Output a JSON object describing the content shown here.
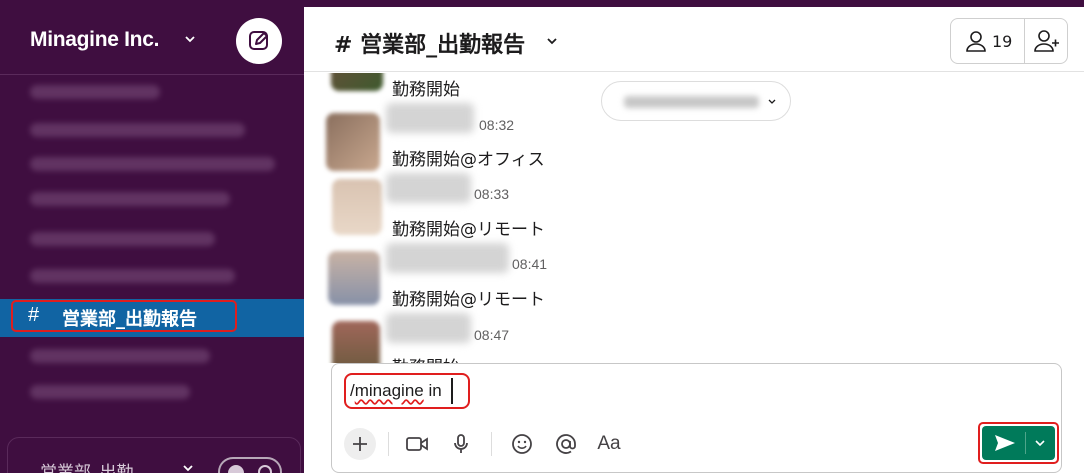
{
  "workspace": {
    "name": "Minagine Inc."
  },
  "channel": {
    "hash": "#",
    "name": "営業部_出勤報告",
    "title": "# 営業部_出勤報告",
    "member_count": "19"
  },
  "messages": [
    {
      "time": "",
      "text": "勤務開始"
    },
    {
      "time": "08:32",
      "text": "勤務開始@オフィス"
    },
    {
      "time": "08:33",
      "text": "勤務開始@リモート"
    },
    {
      "time": "08:41",
      "text": "勤務開始@リモート"
    },
    {
      "time": "08:47",
      "text": "勤務開始"
    }
  ],
  "composer": {
    "value_prefix": "/",
    "value_word": "minagine",
    "value_rest": " in",
    "format_label": "Aa"
  },
  "huddle": {
    "label": "営業部_出勤"
  },
  "icons": [
    "compose-icon",
    "chevron-down-icon",
    "member-icon",
    "add-member-icon",
    "plus-icon",
    "video-icon",
    "microphone-icon",
    "emoji-icon",
    "mention-icon",
    "send-icon",
    "headphones-icon"
  ],
  "colors": {
    "sidebar_bg": "#3f0e40",
    "active_channel": "#1164a3",
    "send_button": "#007a5a",
    "highlight_box": "#e01e1e"
  }
}
